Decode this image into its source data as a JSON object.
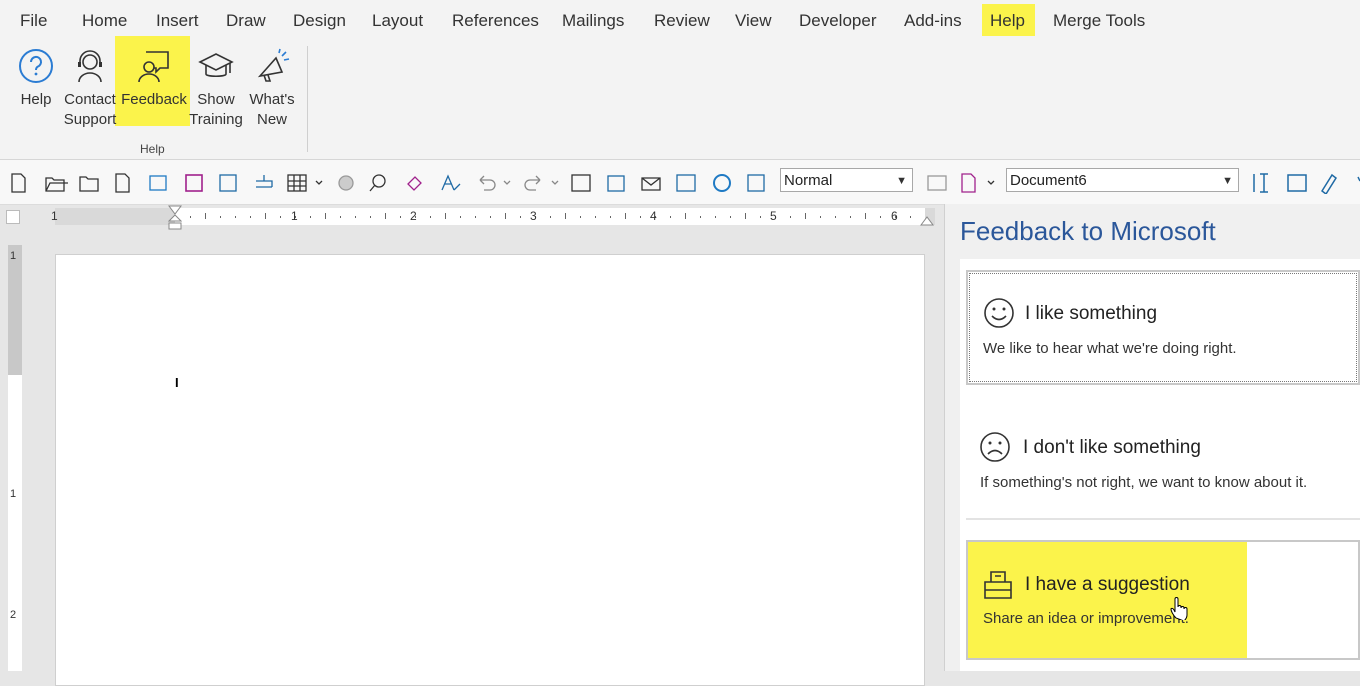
{
  "menu": {
    "tabs": [
      "File",
      "Home",
      "Insert",
      "Draw",
      "Design",
      "Layout",
      "References",
      "Mailings",
      "Review",
      "View",
      "Developer",
      "Add-ins",
      "Help",
      "Merge Tools"
    ],
    "active_tab": "Help"
  },
  "ribbon": {
    "buttons": [
      {
        "label_1": "Help",
        "label_2": "",
        "icon": "help-circle-icon"
      },
      {
        "label_1": "Contact",
        "label_2": "Support",
        "icon": "headset-icon"
      },
      {
        "label_1": "Feedback",
        "label_2": "",
        "icon": "feedback-icon"
      },
      {
        "label_1": "Show",
        "label_2": "Training",
        "icon": "graduation-cap-icon"
      },
      {
        "label_1": "What's",
        "label_2": "New",
        "icon": "megaphone-icon"
      }
    ],
    "group_label": "Help"
  },
  "toolbar": {
    "style_value": "Normal",
    "document_value": "Document6"
  },
  "ruler": {
    "h_numbers": [
      "1",
      "1",
      "2",
      "3",
      "4",
      "5",
      "6"
    ],
    "v_numbers": [
      "1",
      "1",
      "2"
    ]
  },
  "panel": {
    "title": "Feedback to Microsoft",
    "items": [
      {
        "title": "I like something",
        "description": "We like to hear what we're doing right.",
        "icon": "smiley-icon"
      },
      {
        "title": "I don't like something",
        "description": "If something's not right, we want to know about it.",
        "icon": "frown-icon"
      },
      {
        "title": "I have a suggestion",
        "description": "Share an idea or improvement.",
        "icon": "suggestion-box-icon"
      }
    ]
  },
  "colors": {
    "highlight": "#fbf34b",
    "panel_title": "#2b579a",
    "accent_purple": "#7c2c8e"
  }
}
